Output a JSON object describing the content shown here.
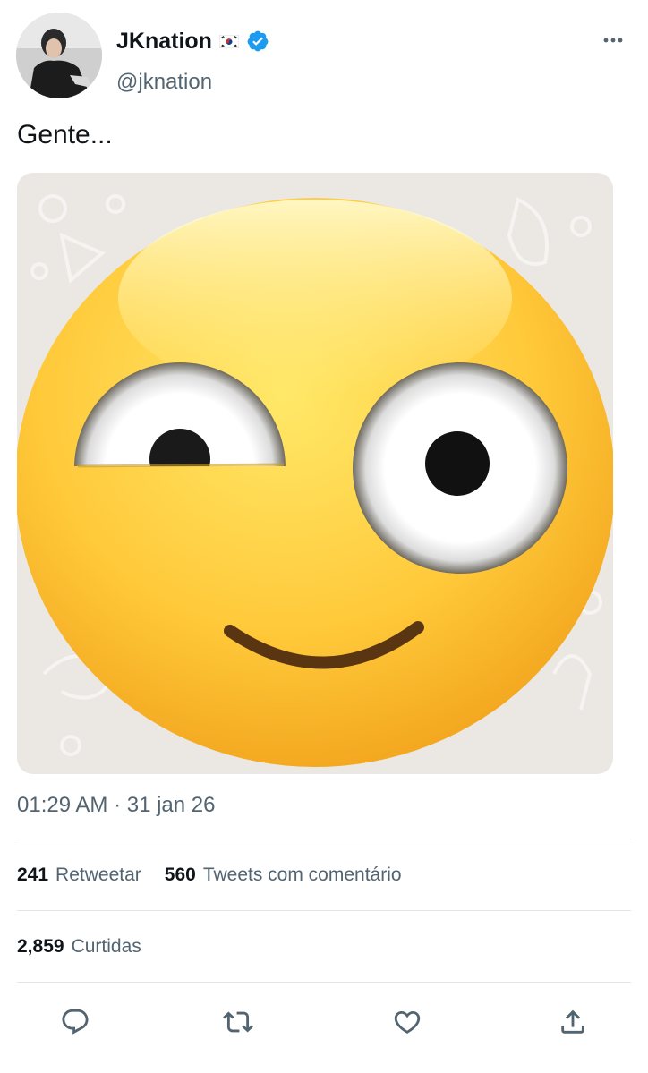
{
  "tweet": {
    "author": {
      "display_name": "JKnation",
      "handle": "@jknation"
    },
    "text": "Gente...",
    "timestamp": "01:29 AM · 31 jan 26",
    "stats": {
      "retweets_count": "241",
      "retweets_label": "Retweetar",
      "quotes_count": "560",
      "quotes_label": "Tweets com comentário",
      "likes_count": "2,859",
      "likes_label": "Curtidas"
    }
  },
  "icons": {
    "more": "more-dots-icon",
    "reply": "reply-icon",
    "retweet": "retweet-icon",
    "like": "heart-icon",
    "share": "share-icon",
    "verified": "verified-badge-icon",
    "flag": "south-korea-flag-icon"
  },
  "colors": {
    "accent": "#1d9bf0",
    "text": "#0f1419",
    "secondary_text": "#536471",
    "divider": "#e1e6ea"
  }
}
